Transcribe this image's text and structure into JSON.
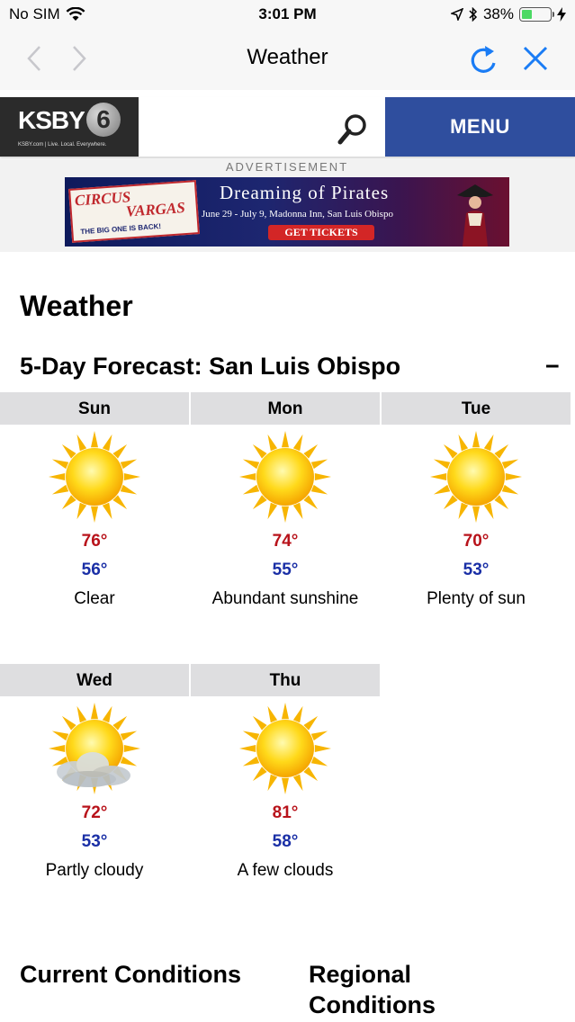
{
  "status_bar": {
    "carrier": "No SIM",
    "time": "3:01 PM",
    "battery": "38%",
    "battery_level": 0.38
  },
  "nav": {
    "title": "Weather"
  },
  "site_header": {
    "logo_text": "KSBY",
    "logo_number": "6",
    "logo_tagline": "KSBY.com | Live. Local. Everywhere.",
    "menu_label": "MENU"
  },
  "ad": {
    "label": "ADVERTISEMENT",
    "line1": "CIRCUS",
    "line2": "VARGAS",
    "line3": "THE BIG ONE IS BACK!",
    "headline": "Dreaming of Pirates",
    "dates": "June 29 - July 9, Madonna Inn, San Luis Obispo",
    "cta": "GET TICKETS"
  },
  "page_title": "Weather",
  "forecast": {
    "title": "5-Day Forecast:  San Luis Obispo",
    "collapse_label": "−",
    "days": [
      {
        "day": "Sun",
        "icon": "sun-icon",
        "high": "76°",
        "low": "56°",
        "condition": "Clear"
      },
      {
        "day": "Mon",
        "icon": "sun-icon",
        "high": "74°",
        "low": "55°",
        "condition": "Abundant sunshine"
      },
      {
        "day": "Tue",
        "icon": "sun-icon",
        "high": "70°",
        "low": "53°",
        "condition": "Plenty of sun"
      },
      {
        "day": "Wed",
        "icon": "partly-cloudy-icon",
        "high": "72°",
        "low": "53°",
        "condition": "Partly cloudy"
      },
      {
        "day": "Thu",
        "icon": "sun-icon",
        "high": "81°",
        "low": "58°",
        "condition": "A few clouds"
      }
    ]
  },
  "sections": {
    "current": "Current Conditions",
    "regional": "Regional Conditions"
  },
  "colors": {
    "high": "#b8131b",
    "low": "#1a2fa6",
    "menu_bg": "#2f4e9e",
    "ios_blue": "#1a7cf5"
  }
}
